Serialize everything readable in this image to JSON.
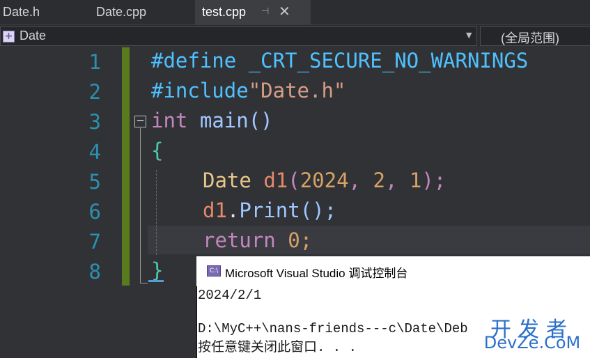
{
  "tabs": [
    {
      "label": "Date.h"
    },
    {
      "label": "Date.cpp"
    },
    {
      "label": "test.cpp",
      "active": true
    }
  ],
  "tab_pin_icon": "pin-icon",
  "tab_close_icon": "close-icon",
  "navbar": {
    "class_icon": "class-icon",
    "class_label": "Date",
    "scope_label": "(全局范围)"
  },
  "editor": {
    "line_numbers": [
      "1",
      "2",
      "3",
      "4",
      "5",
      "6",
      "7",
      "8"
    ],
    "colors": {
      "line_number": "#2b91af",
      "macro": "#c586c0",
      "identifier": "#4fc1ff",
      "string": "#d69d85",
      "type": "#4ec9b0",
      "class": "#e8c88a",
      "variable": "#e8896a",
      "number": "#d6a266",
      "function": "#a0c8ff",
      "change_bar": "#587b1e"
    },
    "code": {
      "l1_directive": "#define",
      "l1_macro": "_CRT_SECURE_NO_WARNINGS",
      "l2_directive": "#include",
      "l2_string": "\"Date.h\"",
      "l3_type": "int",
      "l3_func": "main",
      "l3_parens": "()",
      "l4_brace": "{",
      "l5_class": "Date",
      "l5_var": "d1",
      "l5_open": "(",
      "l5_n1": "2024",
      "l5_c1": ", ",
      "l5_n2": "2",
      "l5_c2": ", ",
      "l5_n3": "1",
      "l5_close": ");",
      "l6_var": "d1",
      "l6_dot": ".",
      "l6_method": "Print",
      "l6_tail": "();",
      "l7_kw": "return",
      "l7_num": "0",
      "l7_semi": ";",
      "l8_brace": "}"
    }
  },
  "console": {
    "icon": "console-icon",
    "title": "Microsoft Visual Studio 调试控制台",
    "lines": [
      "2024/2/1",
      "",
      "D:\\MyC++\\nans-friends---c\\Date\\Deb",
      "按任意键关闭此窗口. . ."
    ]
  },
  "watermark": {
    "cn": "开发者",
    "en": "DevZe.CoM"
  }
}
